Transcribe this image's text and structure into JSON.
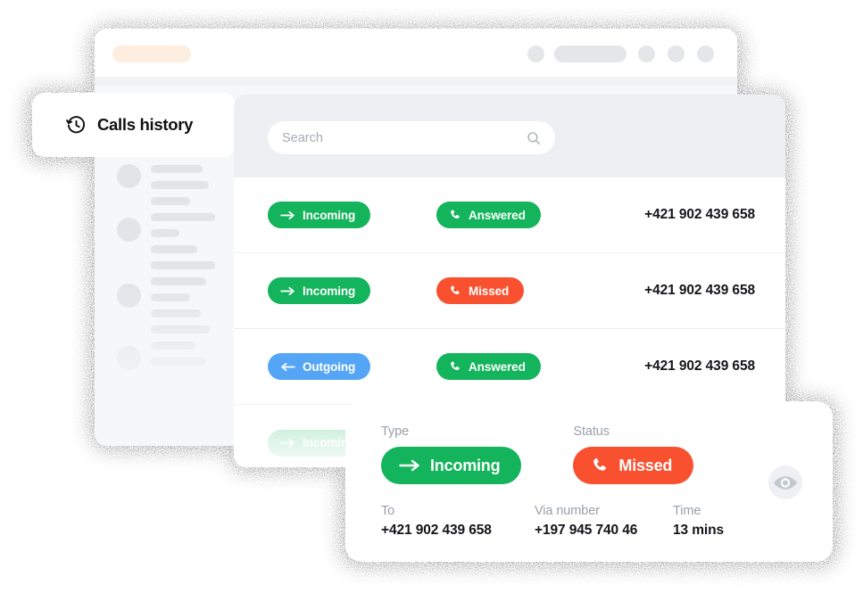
{
  "colors": {
    "green": "#13b45b",
    "red": "#f9512f",
    "blue": "#55a5f6",
    "page_bg": "#ffffff",
    "header_bg": "#edeff2",
    "skeleton": "#e2e4e8",
    "url_pill": "#fdeedf",
    "text_dark": "#15151a",
    "text_muted": "#9aa0a8",
    "eye_bg": "#eef0f3",
    "eye_fill": "#c3c8d1"
  },
  "browser": {
    "url_pill_label": "",
    "chrome_icons": [
      "circle-placeholder",
      "pill-placeholder",
      "circle-placeholder",
      "circle-placeholder",
      "circle-placeholder"
    ]
  },
  "title_card": {
    "icon": "history-clock-icon",
    "title": "Calls history"
  },
  "search": {
    "placeholder": "Search",
    "value": "",
    "icon": "search-icon"
  },
  "table": {
    "rows": [
      {
        "type_label": "Incoming",
        "type_icon": "arrow-right-icon",
        "type_color": "#13b45b",
        "status_label": "Answered",
        "status_icon": "phone-icon",
        "status_color": "#13b45b",
        "number": "+421 902 439 658",
        "faded": false
      },
      {
        "type_label": "Incoming",
        "type_icon": "arrow-right-icon",
        "type_color": "#13b45b",
        "status_label": "Missed",
        "status_icon": "phone-icon",
        "status_color": "#f9512f",
        "number": "+421 902 439 658",
        "faded": false
      },
      {
        "type_label": "Outgoing",
        "type_icon": "arrow-left-icon",
        "type_color": "#55a5f6",
        "status_label": "Answered",
        "status_icon": "phone-icon",
        "status_color": "#13b45b",
        "number": "+421 902 439 658",
        "faded": false
      },
      {
        "type_label": "Incoming",
        "type_icon": "arrow-right-icon",
        "type_color": "#13b45b",
        "status_label": "",
        "status_icon": "",
        "status_color": "",
        "number": "",
        "faded": true
      }
    ]
  },
  "detail": {
    "type_caption": "Type",
    "type_label": "Incoming",
    "type_icon": "arrow-right-icon",
    "type_color": "#13b45b",
    "status_caption": "Status",
    "status_label": "Missed",
    "status_icon": "phone-icon",
    "status_color": "#f9512f",
    "to_caption": "To",
    "to_value": "+421 902 439 658",
    "via_caption": "Via number",
    "via_value": "+197 945 740 46",
    "time_caption": "Time",
    "time_value": "13 mins",
    "eye_icon": "eye-icon"
  }
}
